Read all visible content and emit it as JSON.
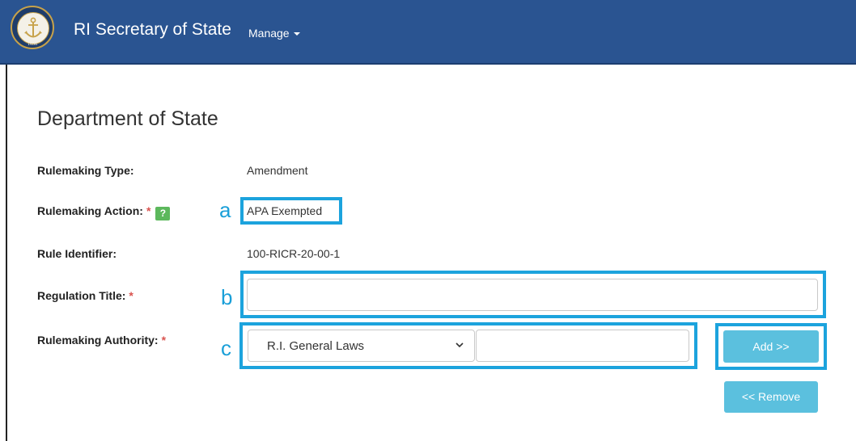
{
  "navbar": {
    "brand": "RI Secretary of State",
    "seal_year": "1636",
    "manage_label": "Manage"
  },
  "page": {
    "heading": "Department of State"
  },
  "form": {
    "rulemaking_type": {
      "label": "Rulemaking Type:",
      "value": "Amendment"
    },
    "rulemaking_action": {
      "label": "Rulemaking Action:",
      "required": "*",
      "help": "?",
      "value": "APA Exempted"
    },
    "rule_identifier": {
      "label": "Rule Identifier:",
      "value": "100-RICR-20-00-1"
    },
    "regulation_title": {
      "label": "Regulation Title:",
      "required": "*",
      "value": "",
      "placeholder": ""
    },
    "rulemaking_authority": {
      "label": "Rulemaking Authority:",
      "required": "*",
      "selected": "R.I. General Laws",
      "input_value": "",
      "add_button": "Add >>",
      "remove_button": "<< Remove"
    }
  },
  "annotations": {
    "a": "a",
    "b": "b",
    "c": "c"
  },
  "colors": {
    "navbar": "#2a5491",
    "highlight": "#1ca3dd",
    "button": "#5bc0de",
    "required": "#d9534f",
    "help_badge": "#5cb85c"
  },
  "icons": {
    "seal": "anchor-seal-icon",
    "dropdown": "chevron-down-icon",
    "manage_caret": "caret-down-icon"
  }
}
